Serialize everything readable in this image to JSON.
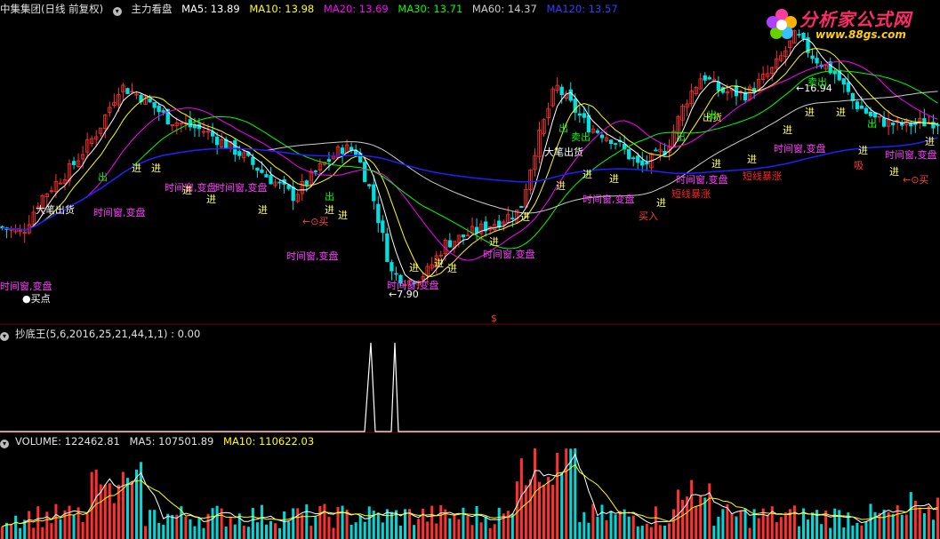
{
  "header": {
    "stock_title": "中集集团(日线 前复权)",
    "indicator_name": "主力看盘",
    "ma": [
      {
        "label": "MA5: 13.89",
        "color": "#ffffff"
      },
      {
        "label": "MA10: 13.98",
        "color": "#ffff00"
      },
      {
        "label": "MA20: 13.69",
        "color": "#ff00ff"
      },
      {
        "label": "MA30: 13.71",
        "color": "#00ff00"
      },
      {
        "label": "MA60: 14.37",
        "color": "#cccccc"
      },
      {
        "label": "MA120: 13.57",
        "color": "#1a1aff"
      }
    ]
  },
  "logo": {
    "name": "分析家公式网",
    "url": "www.88gs.com"
  },
  "indicator_panel": {
    "title": "抄底王(5,6,2016,25,21,44,1,1) : 0.00"
  },
  "volume_panel": {
    "volume": "VOLUME: 122462.81",
    "ma5": "MA5: 107501.89",
    "ma10": "MA10: 110622.03"
  },
  "marker": "$",
  "annotations": {
    "high": "←16.94",
    "low": "←7.90",
    "sell": "卖出",
    "bigsell": "大笔出货",
    "timewindow": "时间窗,变盘",
    "in": "进",
    "out": "出",
    "buy": "买",
    "buypoint": "●买点",
    "buyin": "买入",
    "shortrise": "短线暴涨",
    "chuhuo": "出货",
    "xi": "吸",
    "buy_arrow": "←⊙买"
  },
  "chart_data": {
    "type": "candlestick",
    "price_range_approx": [
      7.9,
      16.94
    ],
    "price_high": 16.94,
    "price_low": 7.9,
    "ma_last": {
      "MA5": 13.89,
      "MA10": 13.98,
      "MA20": 13.69,
      "MA30": 13.71,
      "MA60": 14.37,
      "MA120": 13.57
    },
    "indicator": {
      "name": "抄底王",
      "last": 0.0,
      "spikes": 2
    },
    "volume": {
      "last": 122462.81,
      "ma5": 107501.89,
      "ma10": 110622.03
    }
  }
}
